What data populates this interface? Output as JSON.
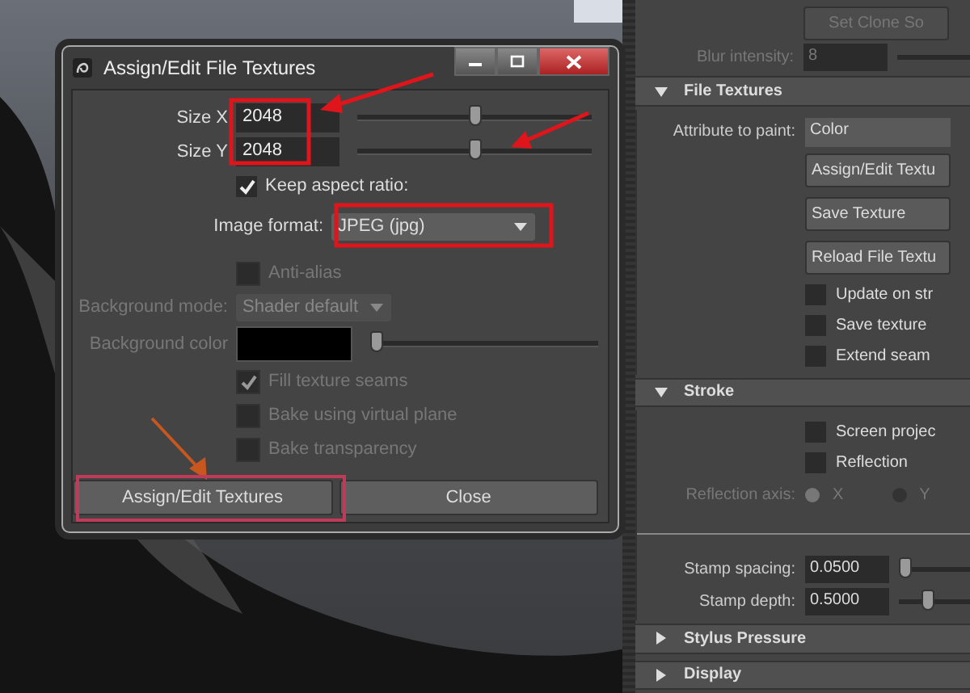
{
  "dialog": {
    "title": "Assign/Edit File Textures",
    "size_fields": [
      {
        "label": "Size X",
        "value": "2048",
        "level": 0.5
      },
      {
        "label": "Size Y",
        "value": "2048",
        "level": 0.5
      }
    ],
    "keep_aspect": {
      "label": "Keep aspect ratio:",
      "checked": true
    },
    "image_format": {
      "label": "Image format:",
      "value": "JPEG (jpg)"
    },
    "anti_alias": {
      "label": "Anti-alias",
      "checked": false,
      "disabled": true
    },
    "background_mode": {
      "label": "Background mode:",
      "value": "Shader default",
      "disabled": true
    },
    "background_color": {
      "label": "Background color",
      "level": 0,
      "disabled": true
    },
    "options": [
      {
        "label": "Fill texture seams",
        "checked": true,
        "disabled": true
      },
      {
        "label": "Bake using virtual plane",
        "checked": false,
        "disabled": true
      },
      {
        "label": "Bake transparency",
        "checked": false,
        "disabled": true
      }
    ],
    "buttons": [
      {
        "label": "Assign/Edit Textures"
      },
      {
        "label": "Close"
      }
    ]
  },
  "panel": {
    "top_button": {
      "label": "Set Clone So",
      "disabled": true
    },
    "blur": {
      "label": "Blur intensity:",
      "value": "8",
      "disabled": true
    },
    "sections": [
      {
        "title": "File Textures",
        "expanded": true,
        "rows": [
          {
            "kind": "dropdown",
            "label": "Attribute to paint:",
            "value": "Color"
          },
          {
            "kind": "button",
            "label": "Assign/Edit Textu"
          },
          {
            "kind": "button",
            "label": "Save Texture"
          },
          {
            "kind": "button",
            "label": "Reload File Textu"
          },
          {
            "kind": "checkbox",
            "label": "Update on str",
            "checked": false
          },
          {
            "kind": "checkbox",
            "label": "Save texture",
            "checked": false
          },
          {
            "kind": "checkbox",
            "label": "Extend seam",
            "checked": false
          }
        ]
      },
      {
        "title": "Stroke",
        "expanded": true,
        "rows": [
          {
            "kind": "checkbox",
            "label": "Screen projec",
            "checked": false
          },
          {
            "kind": "checkbox",
            "label": "Reflection",
            "checked": false
          },
          {
            "kind": "radio",
            "label": "Reflection axis:",
            "disabled": true,
            "options": [
              {
                "label": "X",
                "selected": true
              },
              {
                "label": "Y",
                "selected": false
              }
            ]
          },
          {
            "kind": "field",
            "label": "Stamp spacing:",
            "value": "0.0500",
            "level": 0.0
          },
          {
            "kind": "field",
            "label": "Stamp depth:",
            "value": "0.5000",
            "level": 0.12
          }
        ]
      },
      {
        "title": "Stylus Pressure",
        "expanded": false
      },
      {
        "title": "Display",
        "expanded": false
      }
    ]
  }
}
